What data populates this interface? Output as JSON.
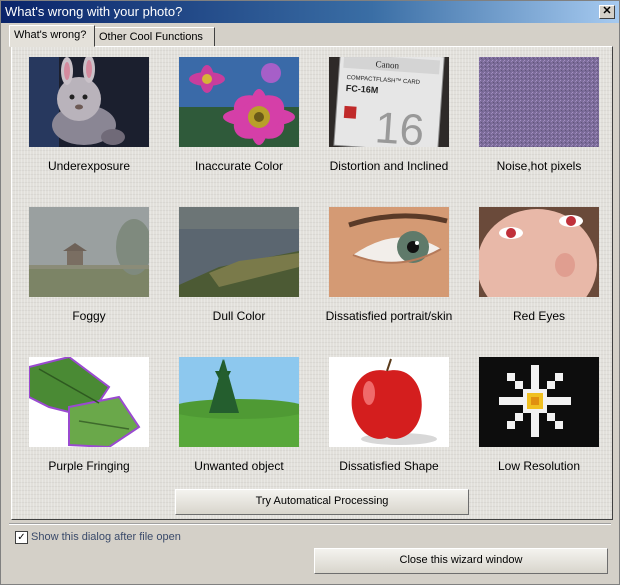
{
  "window": {
    "title": "What's wrong with your photo?",
    "close_glyph": "✕"
  },
  "tabs": [
    {
      "label": "What's wrong?",
      "active": true
    },
    {
      "label": "Other Cool Functions",
      "active": false
    }
  ],
  "items": [
    {
      "label": "Underexposure",
      "icon": "teddy-bear-dark-photo"
    },
    {
      "label": "Inaccurate Color",
      "icon": "pink-flower-photo"
    },
    {
      "label": "Distortion and Inclined",
      "icon": "compactflash-card-photo"
    },
    {
      "label": "Noise,hot pixels",
      "icon": "noise-texture-photo"
    },
    {
      "label": "Foggy",
      "icon": "foggy-landscape-photo"
    },
    {
      "label": "Dull Color",
      "icon": "lake-shore-photo"
    },
    {
      "label": "Dissatisfied portrait/skin",
      "icon": "eye-closeup-photo"
    },
    {
      "label": "Red Eyes",
      "icon": "red-eyes-face-photo"
    },
    {
      "label": "Purple Fringing",
      "icon": "leaves-fringing-photo"
    },
    {
      "label": "Unwanted object",
      "icon": "tree-field-photo"
    },
    {
      "label": "Dissatisfied Shape",
      "icon": "red-apple-photo"
    },
    {
      "label": "Low Resolution",
      "icon": "pixelated-flower-photo"
    }
  ],
  "card_text": {
    "brand": "Canon",
    "type": "COMPACTFLASH™ CARD",
    "model": "FC-16M",
    "size": "16"
  },
  "buttons": {
    "auto": "Try Automatical Processing",
    "close_wizard": "Close this wizard window"
  },
  "checkbox": {
    "label": "Show this dialog after file open",
    "checked": true,
    "glyph": "✓"
  }
}
